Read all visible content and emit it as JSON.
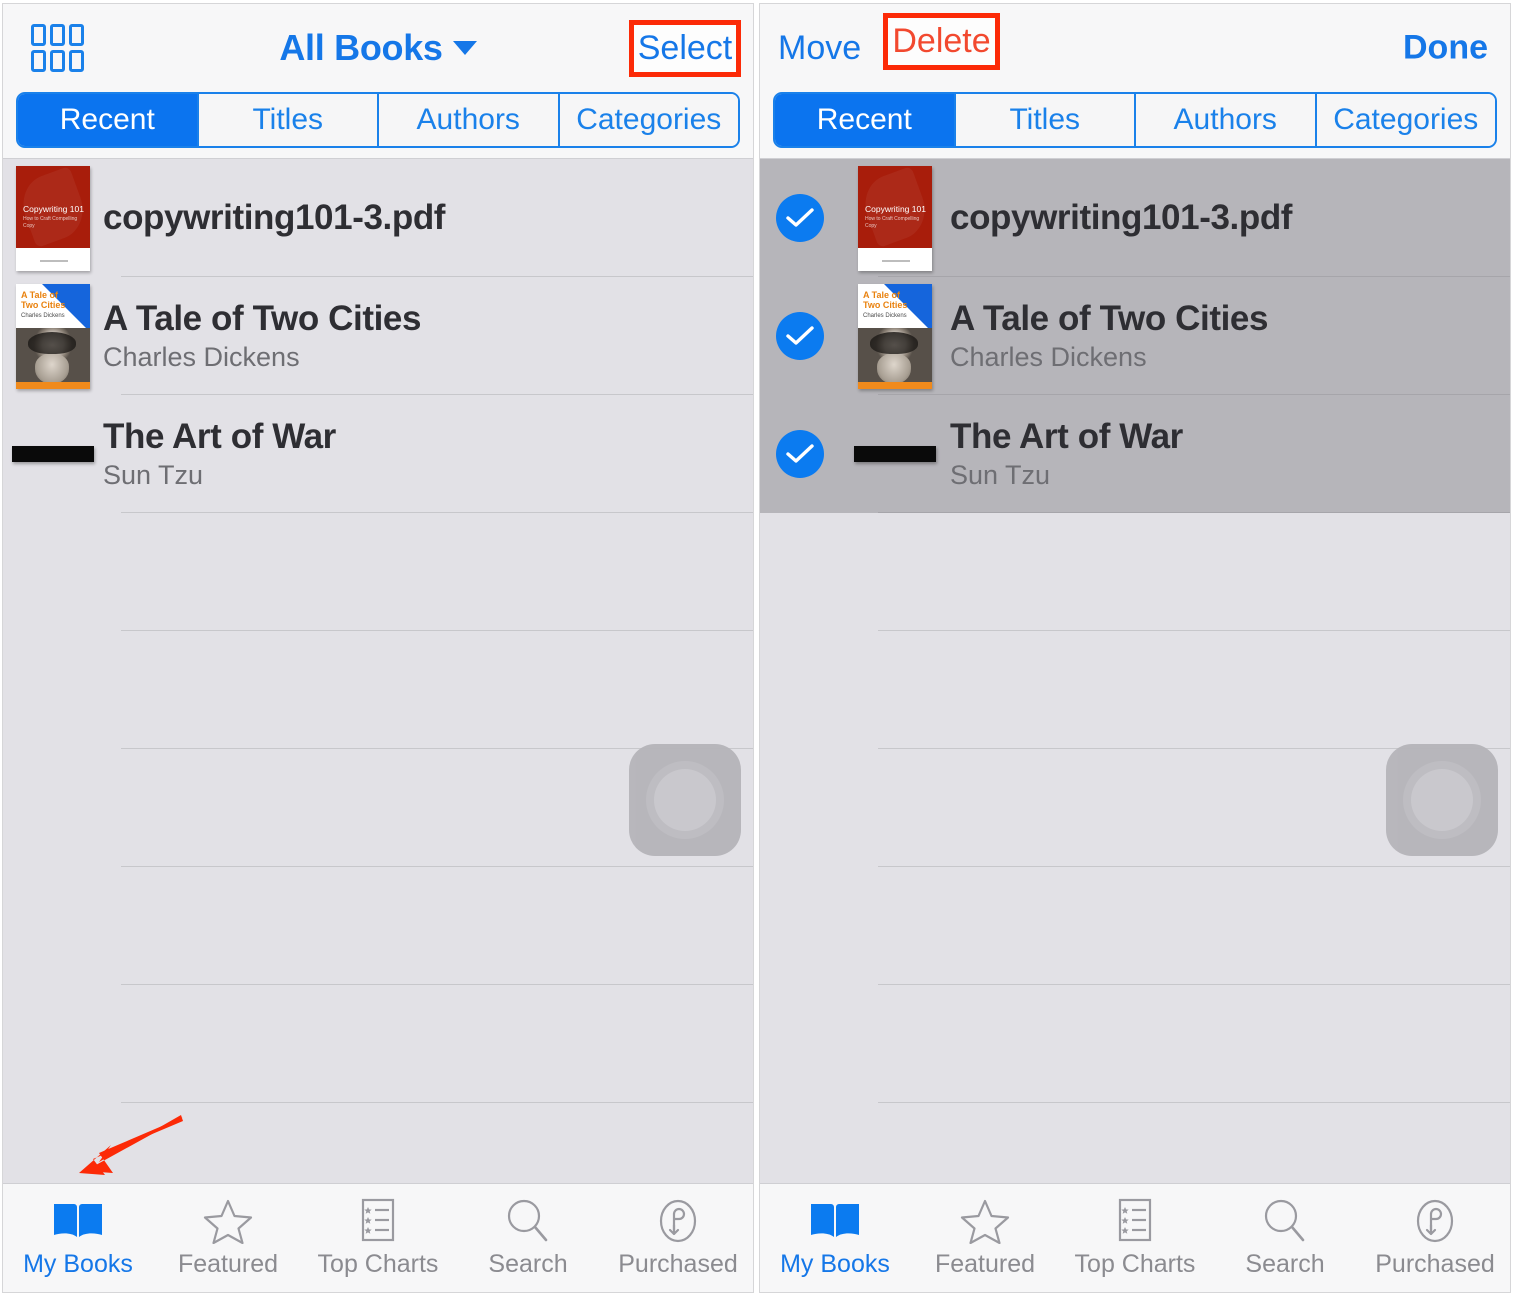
{
  "colors": {
    "accent_blue": "#1577e8",
    "segment_active": "#0b74ef",
    "delete_red": "#f2492f",
    "annotation_red": "#fc2a07",
    "checkmark_blue": "#0b7bf0",
    "list_background": "#e2e1e6",
    "selected_row": "#b6b5ba"
  },
  "left_screen": {
    "navbar": {
      "grid_icon_name": "grid-view-icon",
      "title": "All Books",
      "caret_icon_name": "chevron-down-icon",
      "select_label": "Select"
    },
    "segments": [
      {
        "label": "Recent",
        "active": true
      },
      {
        "label": "Titles",
        "active": false
      },
      {
        "label": "Authors",
        "active": false
      },
      {
        "label": "Categories",
        "active": false
      }
    ],
    "books": [
      {
        "title": "copywriting101-3.pdf",
        "author": "",
        "cover": "copywriting",
        "selected": false
      },
      {
        "title": "A Tale of Two Cities",
        "author": "Charles Dickens",
        "cover": "tale",
        "selected": false
      },
      {
        "title": "The Art of War",
        "author": "Sun Tzu",
        "cover": "thin",
        "selected": false
      }
    ],
    "assistive_touch_name": "assistive-touch-button",
    "tabs": [
      {
        "label": "My Books",
        "icon": "open-book-icon",
        "active": true
      },
      {
        "label": "Featured",
        "icon": "star-icon",
        "active": false
      },
      {
        "label": "Top Charts",
        "icon": "chart-list-icon",
        "active": false
      },
      {
        "label": "Search",
        "icon": "magnifier-icon",
        "active": false
      },
      {
        "label": "Purchased",
        "icon": "purchased-download-icon",
        "active": false
      }
    ]
  },
  "right_screen": {
    "navbar": {
      "move_label": "Move",
      "delete_label": "Delete",
      "done_label": "Done"
    },
    "segments": [
      {
        "label": "Recent",
        "active": true
      },
      {
        "label": "Titles",
        "active": false
      },
      {
        "label": "Authors",
        "active": false
      },
      {
        "label": "Categories",
        "active": false
      }
    ],
    "books": [
      {
        "title": "copywriting101-3.pdf",
        "author": "",
        "cover": "copywriting",
        "selected": true
      },
      {
        "title": "A Tale of Two Cities",
        "author": "Charles Dickens",
        "cover": "tale",
        "selected": true
      },
      {
        "title": "The Art of War",
        "author": "Sun Tzu",
        "cover": "thin",
        "selected": true
      }
    ],
    "assistive_touch_name": "assistive-touch-button",
    "tabs": [
      {
        "label": "My Books",
        "icon": "open-book-icon",
        "active": true
      },
      {
        "label": "Featured",
        "icon": "star-icon",
        "active": false
      },
      {
        "label": "Top Charts",
        "icon": "chart-list-icon",
        "active": false
      },
      {
        "label": "Search",
        "icon": "magnifier-icon",
        "active": false
      },
      {
        "label": "Purchased",
        "icon": "purchased-download-icon",
        "active": false
      }
    ]
  },
  "cover_art": {
    "copywriting": {
      "line1": "Copywriting 101",
      "line2": "How to Craft Compelling Copy"
    },
    "tale": {
      "title_line1": "A Tale of",
      "title_line2": "Two Cities",
      "author": "Charles Dickens"
    }
  },
  "annotations": {
    "select_box_name": "select-highlight-box",
    "delete_box_name": "delete-highlight-box",
    "arrow_name": "my-books-pointer-arrow"
  }
}
